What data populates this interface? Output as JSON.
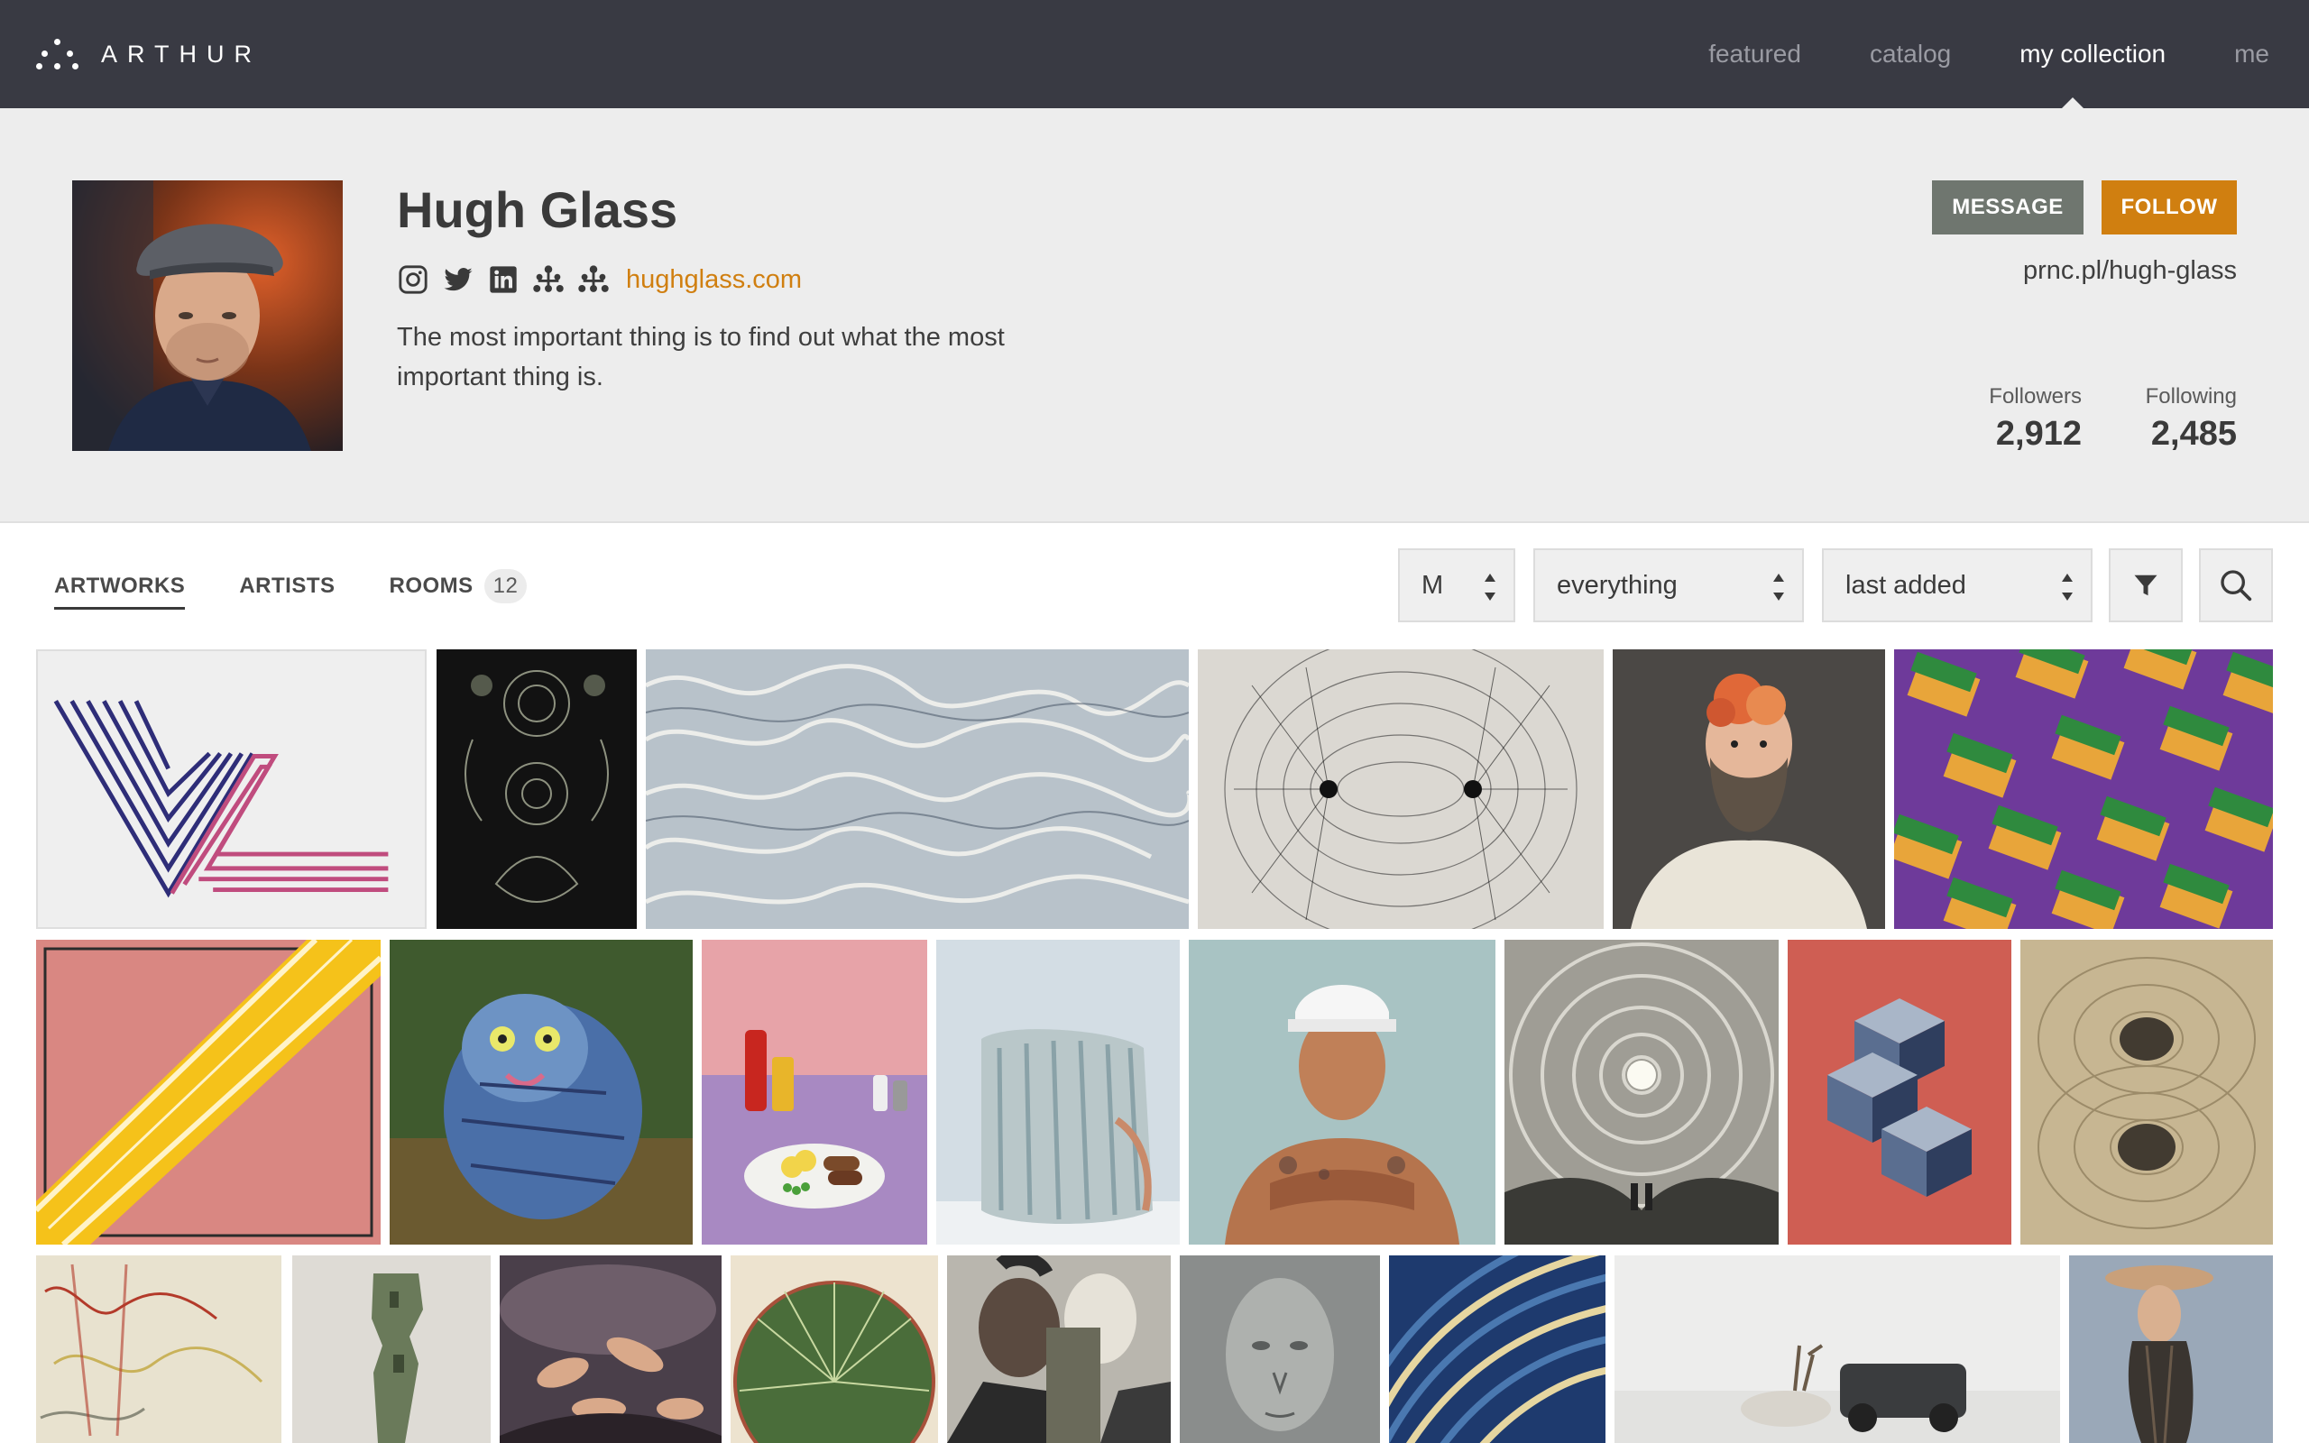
{
  "topbar": {
    "brand": "ARTHUR",
    "nav": [
      {
        "label": "featured",
        "active": false
      },
      {
        "label": "catalog",
        "active": false
      },
      {
        "label": "my collection",
        "active": true
      },
      {
        "label": "me",
        "active": false
      }
    ]
  },
  "profile": {
    "name": "Hugh Glass",
    "social_icons": [
      "instagram-icon",
      "twitter-icon",
      "linkedin-icon",
      "arthur-icon",
      "arthur-icon"
    ],
    "website": "hughglass.com",
    "bio": "The most important thing is to find out what the most important thing is.",
    "message_label": "MESSAGE",
    "follow_label": "FOLLOW",
    "short_url": "prnc.pl/hugh-glass",
    "followers_label": "Followers",
    "followers_count": "2,912",
    "following_label": "Following",
    "following_count": "2,485"
  },
  "tabs": {
    "artworks": "ARTWORKS",
    "artists": "ARTISTS",
    "rooms": "ROOMS",
    "rooms_count": "12"
  },
  "filters": {
    "size": "M",
    "scope": "everything",
    "sort": "last added"
  },
  "colors": {
    "topbar": "#393a43",
    "accent": "#d07f10",
    "message_button": "#6f766f",
    "profile_bg": "#ededed"
  },
  "grid": {
    "artwork_count_visible": 24
  }
}
